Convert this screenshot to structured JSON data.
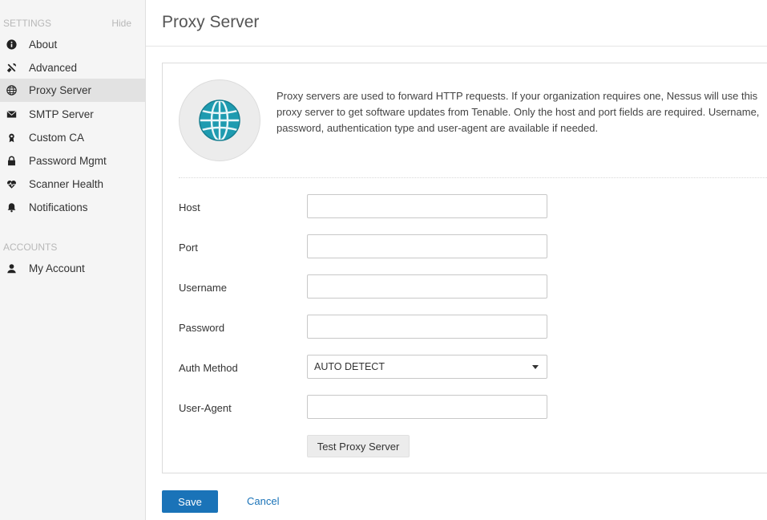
{
  "sidebar": {
    "settings_heading": "SETTINGS",
    "hide_label": "Hide",
    "items": [
      {
        "label": "About",
        "icon": "info-icon"
      },
      {
        "label": "Advanced",
        "icon": "tools-icon"
      },
      {
        "label": "Proxy Server",
        "icon": "globe-icon",
        "active": true
      },
      {
        "label": "SMTP Server",
        "icon": "envelope-icon"
      },
      {
        "label": "Custom CA",
        "icon": "certificate-icon"
      },
      {
        "label": "Password Mgmt",
        "icon": "lock-icon"
      },
      {
        "label": "Scanner Health",
        "icon": "heartbeat-icon"
      },
      {
        "label": "Notifications",
        "icon": "bell-icon"
      }
    ],
    "accounts_heading": "ACCOUNTS",
    "account_items": [
      {
        "label": "My Account",
        "icon": "user-icon"
      }
    ]
  },
  "main": {
    "title": "Proxy Server",
    "description": "Proxy servers are used to forward HTTP requests. If your organization requires one, Nessus will use this proxy server to get software updates from Tenable. Only the host and port fields are required. Username, password, authentication type and user-agent are available if needed.",
    "fields": {
      "host": {
        "label": "Host",
        "value": ""
      },
      "port": {
        "label": "Port",
        "value": ""
      },
      "username": {
        "label": "Username",
        "value": ""
      },
      "password": {
        "label": "Password",
        "value": ""
      },
      "auth_method": {
        "label": "Auth Method",
        "value": "AUTO DETECT"
      },
      "user_agent": {
        "label": "User-Agent",
        "value": ""
      }
    },
    "test_button": "Test Proxy Server",
    "save_button": "Save",
    "cancel_link": "Cancel"
  },
  "colors": {
    "accent": "#1a73b8",
    "globe": "#1e9bb0",
    "sidebar_bg": "#f5f5f5",
    "active_bg": "#e2e2e2"
  }
}
